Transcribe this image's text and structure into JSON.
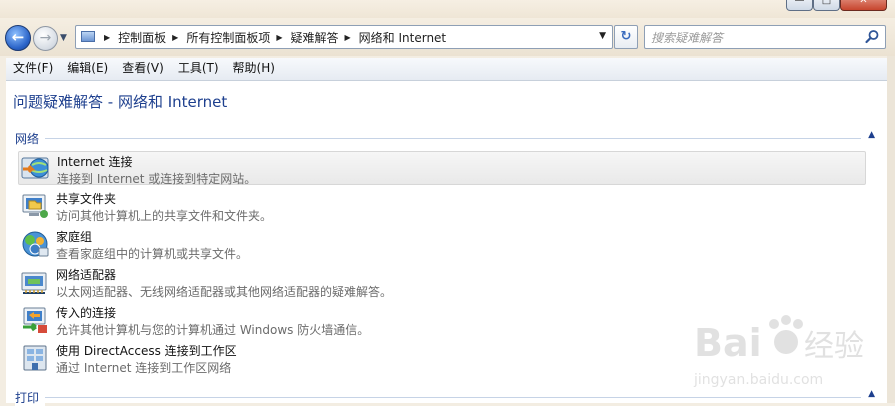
{
  "window": {
    "minimize_glyph": "—",
    "maximize_glyph": "□",
    "close_glyph": "✕"
  },
  "nav": {
    "back_glyph": "←",
    "forward_glyph": "→",
    "history_glyph": "▼",
    "breadcrumbs": [
      "控制面板",
      "所有控制面板项",
      "疑难解答",
      "网络和 Internet"
    ],
    "breadcrumb_separator": "▶",
    "address_dropdown_glyph": "▼",
    "refresh_glyph": "↻",
    "search_placeholder": "搜索疑难解答"
  },
  "menu": [
    "文件(F)",
    "编辑(E)",
    "查看(V)",
    "工具(T)",
    "帮助(H)"
  ],
  "page": {
    "title": "问题疑难解答 - 网络和 Internet"
  },
  "groups": [
    {
      "label": "网络",
      "toggle_glyph": "▲",
      "items": [
        {
          "title": "Internet 连接",
          "desc": "连接到 Internet 或连接到特定网站。",
          "icon": "internet-connection-icon",
          "highlighted": true
        },
        {
          "title": "共享文件夹",
          "desc": "访问其他计算机上的共享文件和文件夹。",
          "icon": "shared-folders-icon",
          "highlighted": false
        },
        {
          "title": "家庭组",
          "desc": "查看家庭组中的计算机或共享文件。",
          "icon": "homegroup-icon",
          "highlighted": false
        },
        {
          "title": "网络适配器",
          "desc": "以太网适配器、无线网络适配器或其他网络适配器的疑难解答。",
          "icon": "network-adapter-icon",
          "highlighted": false
        },
        {
          "title": "传入的连接",
          "desc": "允许其他计算机与您的计算机通过 Windows 防火墙通信。",
          "icon": "incoming-connections-icon",
          "highlighted": false
        },
        {
          "title": "使用 DirectAccess 连接到工作区",
          "desc": "通过 Internet 连接到工作区网络",
          "icon": "directaccess-icon",
          "highlighted": false
        }
      ]
    },
    {
      "label": "打印",
      "toggle_glyph": "▲"
    }
  ],
  "watermark": {
    "brand": "Bai",
    "brand_tail": "经验",
    "url": "jingyan.baidu.com"
  },
  "colors": {
    "link_blue": "#1d3f8e",
    "hover_bg": "#eaeaea"
  }
}
